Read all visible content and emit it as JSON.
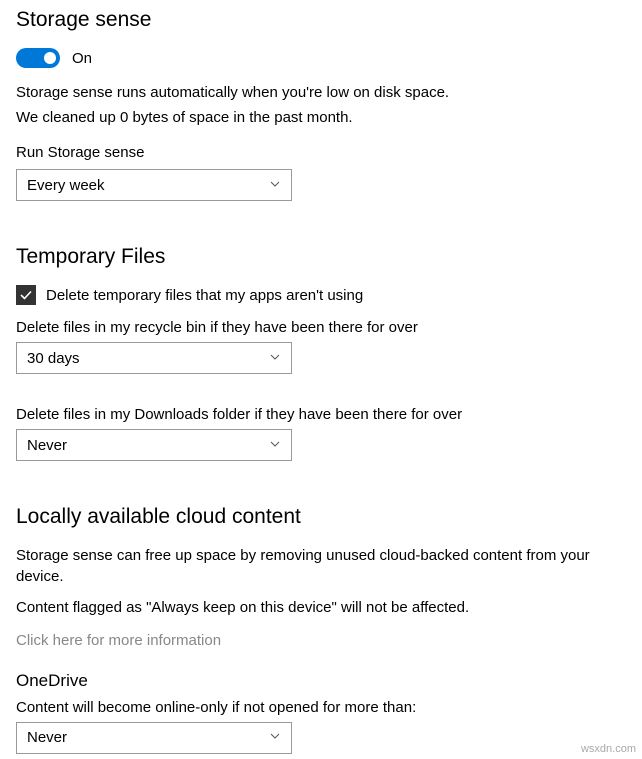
{
  "storage_sense": {
    "heading": "Storage sense",
    "toggle_state": "On",
    "desc1": "Storage sense runs automatically when you're low on disk space.",
    "desc2": "We cleaned up 0 bytes of space in the past month.",
    "run_label": "Run Storage sense",
    "run_value": "Every week"
  },
  "temp_files": {
    "heading": "Temporary Files",
    "delete_temp_label": "Delete temporary files that my apps aren't using",
    "recycle_label": "Delete files in my recycle bin if they have been there for over",
    "recycle_value": "30 days",
    "downloads_label": "Delete files in my Downloads folder if they have been there for over",
    "downloads_value": "Never"
  },
  "cloud": {
    "heading": "Locally available cloud content",
    "desc1": "Storage sense can free up space by removing unused cloud-backed content from your device.",
    "desc2": "Content flagged as \"Always keep on this device\" will not be affected.",
    "link": "Click here for more information",
    "onedrive_heading": "OneDrive",
    "onedrive_desc": "Content will become online-only if not opened for more than:",
    "onedrive_value": "Never"
  },
  "footer": "wsxdn.com"
}
